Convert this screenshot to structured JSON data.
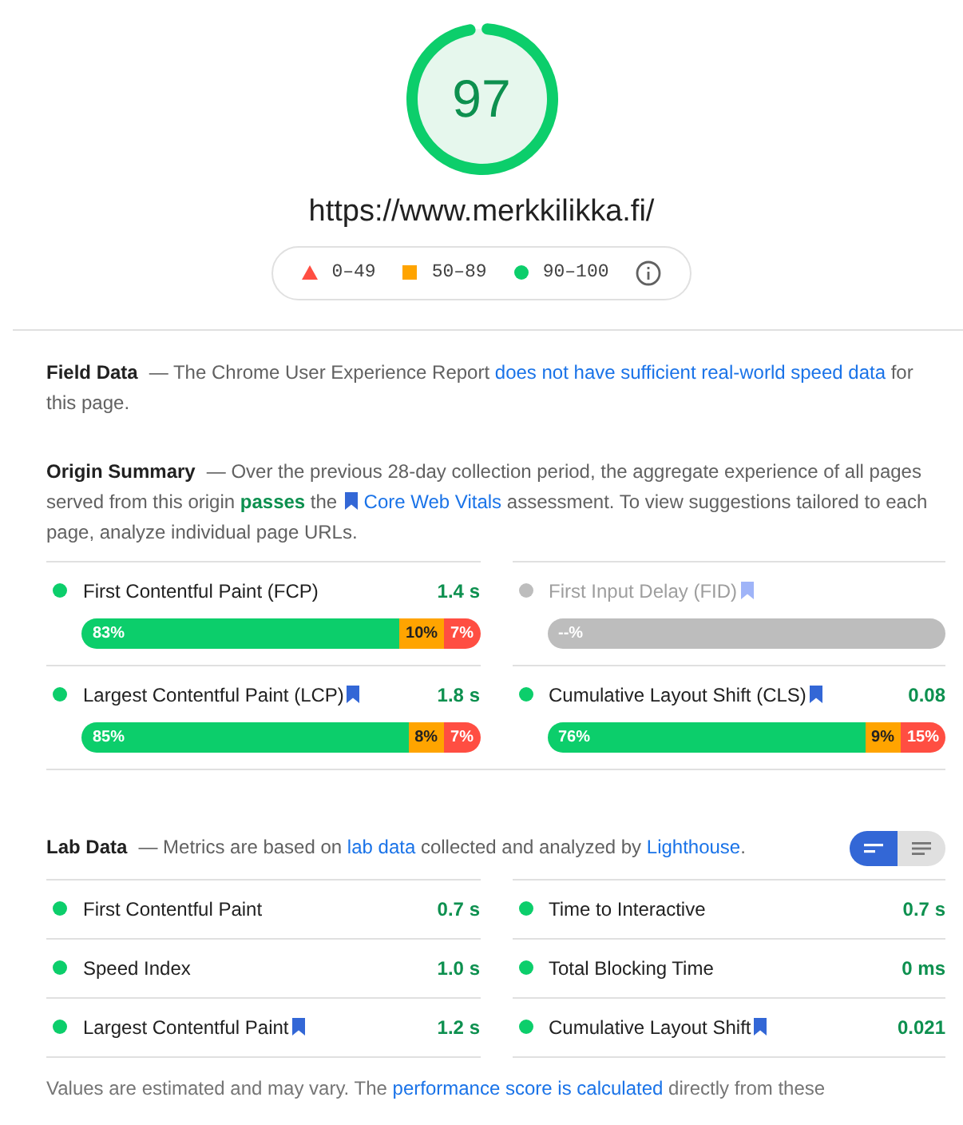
{
  "score": {
    "value": "97"
  },
  "url": "https://www.merkkilikka.fi/",
  "legend": [
    {
      "kind": "triangle",
      "label": "0–49",
      "color": "#ff4e42"
    },
    {
      "kind": "square",
      "label": "50–89",
      "color": "#ffa400"
    },
    {
      "kind": "circle",
      "label": "90–100",
      "color": "#0cce6b"
    }
  ],
  "field_data": {
    "title": "Field Data",
    "description": [
      {
        "kind": "text",
        "text": "— The Chrome User Experience Report "
      },
      {
        "kind": "link",
        "text": "does not have sufficient real-world speed data"
      },
      {
        "kind": "text",
        "text": " for this page."
      }
    ]
  },
  "origin_summary": {
    "title": "Origin Summary",
    "description": [
      {
        "kind": "text",
        "text": "— Over the previous 28-day collection period, the aggregate experience of all pages served from this origin "
      },
      {
        "kind": "pass",
        "text": "passes"
      },
      {
        "kind": "text",
        "text": " the "
      },
      {
        "kind": "link",
        "bookmark": true,
        "text": "Core Web Vitals"
      },
      {
        "kind": "text",
        "text": " assessment. To view suggestions tailored to each page, analyze individual page URLs."
      }
    ],
    "metrics": [
      {
        "name": "First Contentful Paint (FCP)",
        "value": "1.4 s",
        "color": "#0cce6b",
        "bookmark": false,
        "disabled": false,
        "segments": [
          {
            "label": "83%",
            "color": "#0cce6b"
          },
          {
            "label": "10%",
            "color": "#ffa400"
          },
          {
            "label": "7%",
            "color": "#ff4e42"
          }
        ]
      },
      {
        "name": "First Input Delay (FID)",
        "color": "#bdbdbd",
        "bookmark": true,
        "disabled": true,
        "segments": [
          {
            "label": "--%",
            "color": "#bdbdbd"
          }
        ]
      },
      {
        "name": "Largest Contentful Paint (LCP)",
        "value": "1.8 s",
        "color": "#0cce6b",
        "bookmark": true,
        "disabled": false,
        "segments": [
          {
            "label": "85%",
            "color": "#0cce6b"
          },
          {
            "label": "8%",
            "color": "#ffa400"
          },
          {
            "label": "7%",
            "color": "#ff4e42"
          }
        ]
      },
      {
        "name": "Cumulative Layout Shift (CLS)",
        "value": "0.08",
        "color": "#0cce6b",
        "bookmark": true,
        "disabled": false,
        "segments": [
          {
            "label": "76%",
            "color": "#0cce6b"
          },
          {
            "label": "9%",
            "color": "#ffa400"
          },
          {
            "label": "15%",
            "color": "#ff4e42"
          }
        ]
      }
    ]
  },
  "lab_data": {
    "title": "Lab Data",
    "description": [
      {
        "kind": "text",
        "text": "— Metrics are based on "
      },
      {
        "kind": "link",
        "text": "lab data"
      },
      {
        "kind": "text",
        "text": " collected and analyzed by "
      },
      {
        "kind": "link",
        "text": "Lighthouse"
      },
      {
        "kind": "text",
        "text": "."
      }
    ],
    "view_toggle": [
      {
        "kind": "short",
        "selected": true
      },
      {
        "kind": "long",
        "selected": false
      }
    ],
    "metrics": [
      {
        "name": "First Contentful Paint",
        "value": "0.7 s",
        "color": "#0cce6b",
        "bookmark": false
      },
      {
        "name": "Time to Interactive",
        "value": "0.7 s",
        "color": "#0cce6b",
        "bookmark": false
      },
      {
        "name": "Speed Index",
        "value": "1.0 s",
        "color": "#0cce6b",
        "bookmark": false
      },
      {
        "name": "Total Blocking Time",
        "value": "0 ms",
        "color": "#0cce6b",
        "bookmark": false
      },
      {
        "name": "Largest Contentful Paint",
        "value": "1.2 s",
        "color": "#0cce6b",
        "bookmark": true
      },
      {
        "name": "Cumulative Layout Shift",
        "value": "0.021",
        "color": "#0cce6b",
        "bookmark": true
      }
    ]
  },
  "footer": [
    {
      "kind": "text",
      "text": "Values are estimated and may vary. The "
    },
    {
      "kind": "link",
      "text": "performance score is calculated"
    },
    {
      "kind": "text",
      "text": " directly from these"
    }
  ]
}
